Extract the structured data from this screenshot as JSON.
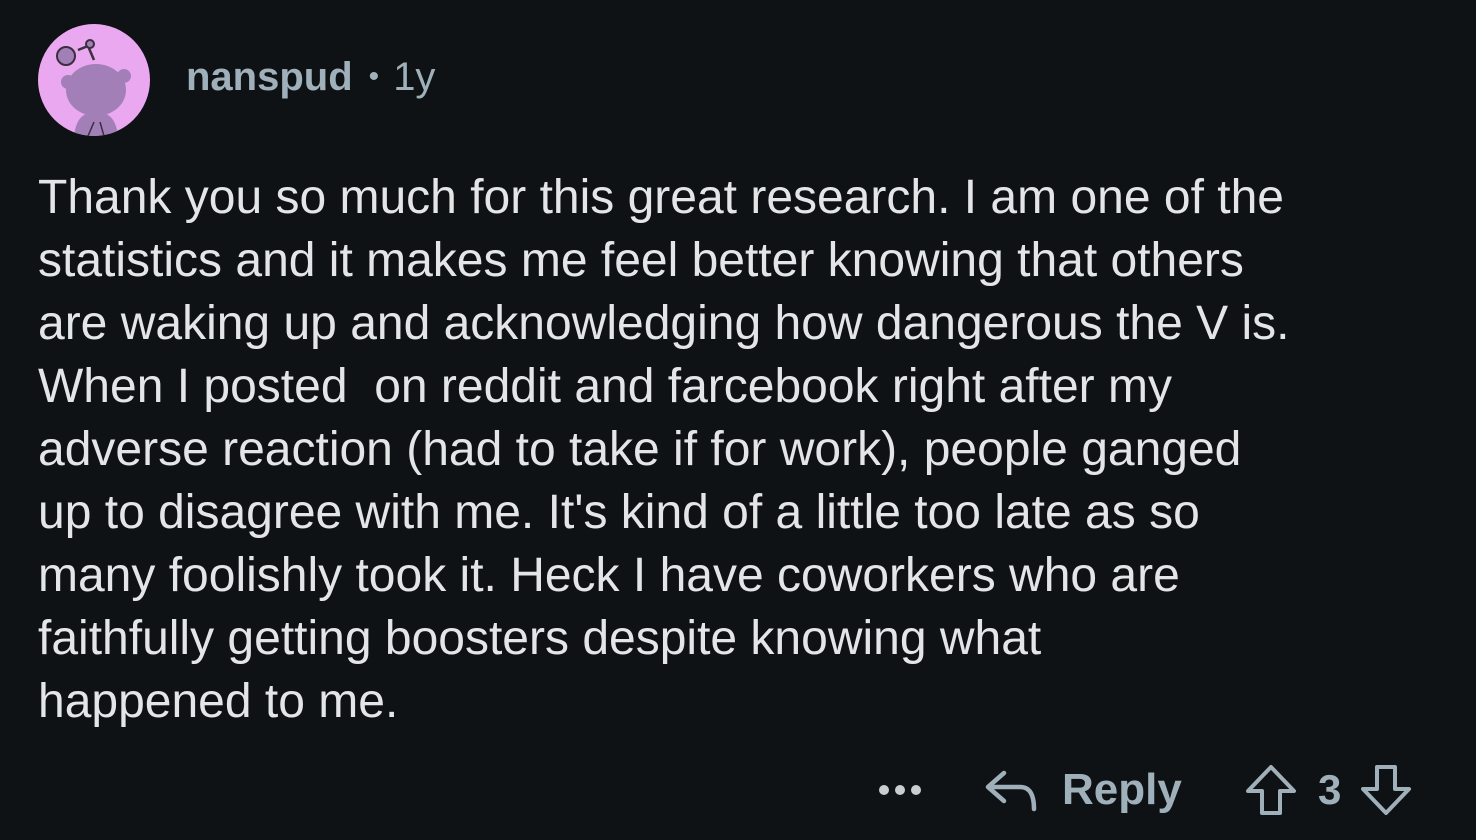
{
  "comment": {
    "author": "nanspud",
    "separator": "•",
    "age": "1y",
    "text": "Thank you so much for this great research. I am one of the\nstatistics and it makes me feel better knowing that others\nare waking up and acknowledging how dangerous the V is.\nWhen I posted  on reddit and farcebook right after my\nadverse reaction (had to take if for work), people ganged\nup to disagree with me. It's kind of a little too late as so\nmany foolishly took it. Heck I have coworkers who are\nfaithfully getting boosters despite knowing what\nhappened to me.",
    "avatar_icon": "snoo-avatar-icon",
    "avatar_bg": "#e9a8f0"
  },
  "actions": {
    "more_icon": "more-options-icon",
    "reply_icon": "reply-arrow-icon",
    "reply_label": "Reply",
    "upvote_icon": "upvote-arrow-icon",
    "vote_count": "3",
    "downvote_icon": "downvote-arrow-icon"
  },
  "colors": {
    "background": "#0f1214",
    "text": "#e3e5e7",
    "meta": "#9fb0bb"
  }
}
